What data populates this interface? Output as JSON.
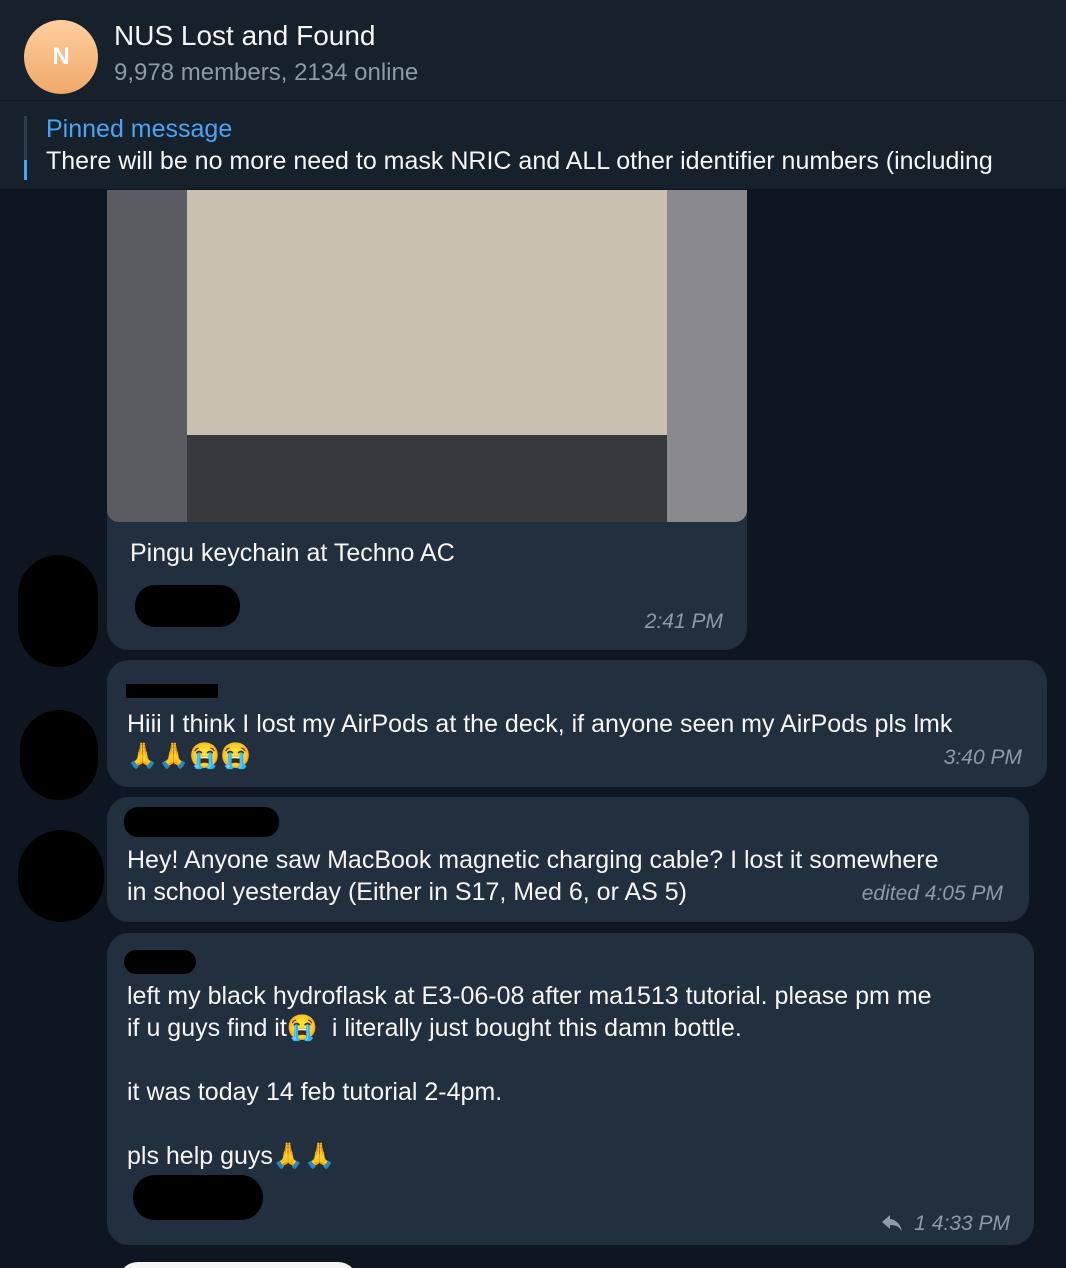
{
  "chat": {
    "avatar_letter": "N",
    "title": "NUS Lost and Found",
    "subtitle": "9,978 members, 2134 online"
  },
  "pinned": {
    "label": "Pinned message",
    "text": "There will be no more need to mask NRIC and ALL other identifier numbers (including"
  },
  "messages": [
    {
      "text": "Pingu keychain at Techno AC",
      "time": "2:41 PM"
    },
    {
      "text": "Hiii I think I lost my AirPods at the deck, if anyone seen my AirPods pls lmk\n🙏🙏😭😭",
      "time": "3:40 PM"
    },
    {
      "text": "Hey! Anyone saw MacBook magnetic charging cable? I lost it somewhere\nin school yesterday (Either in S17, Med 6, or AS 5)",
      "time": "edited 4:05 PM"
    },
    {
      "text": "left my black hydroflask at E3-06-08 after ma1513 tutorial. please pm me\nif u guys find it😭  i literally just bought this damn bottle.\n\nit was today 14 feb tutorial 2-4pm.\n\npls help guys🙏🙏",
      "time": "1 4:33 PM",
      "reply_icon": "reply-arrow-icon"
    }
  ],
  "colors": {
    "accent": "#4aa3f5",
    "bubble": "#222f3e",
    "background": "#0e1621"
  }
}
